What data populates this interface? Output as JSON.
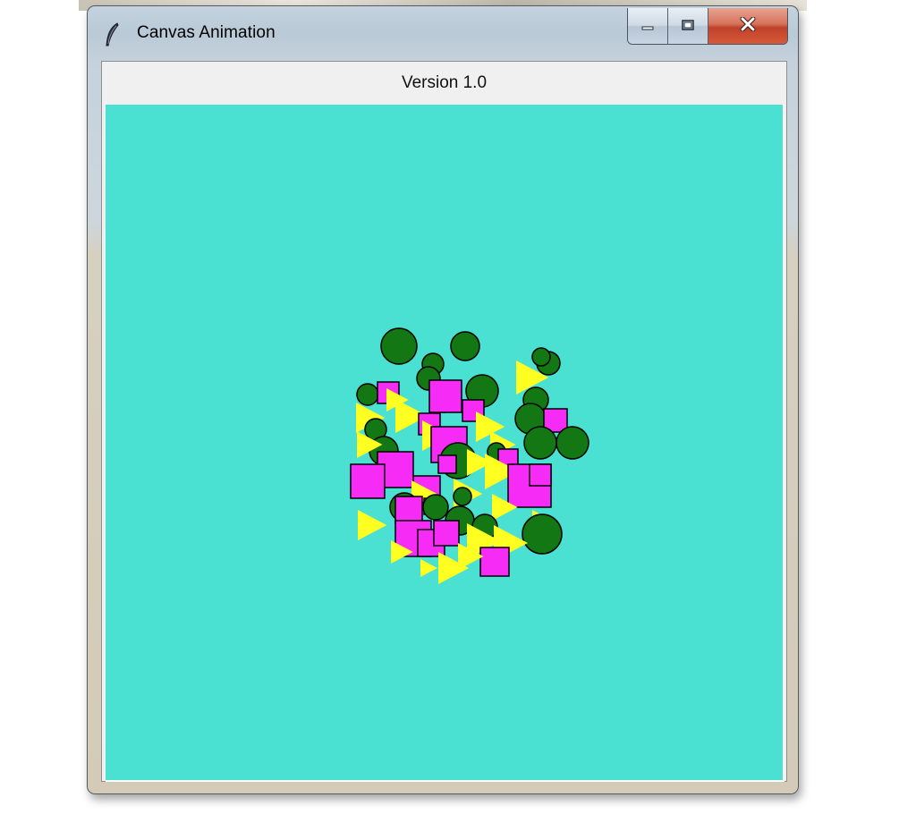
{
  "window": {
    "title": "Canvas Animation"
  },
  "header": {
    "version_label": "Version 1.0"
  },
  "canvas": {
    "background": "#4ae0d2",
    "colors": {
      "circle": "#137813",
      "square": "#f62cf6",
      "triangle": "#ffff22"
    }
  },
  "icons": {
    "app": "feather-icon",
    "minimize": "minimize-icon",
    "maximize": "maximize-icon",
    "close": "close-icon"
  }
}
